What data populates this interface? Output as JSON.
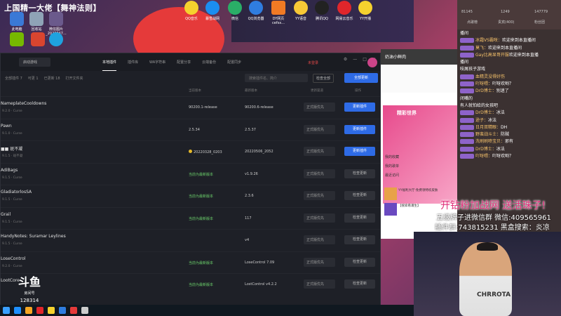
{
  "stream": {
    "title": "上国精一大佬【舞神法则】",
    "douyu_logo": "斗鱼",
    "douyu_sub": "房间号",
    "room_id": "128314"
  },
  "desktop_icons": [
    "此电脑",
    "回收站",
    "微信图片_2022047..."
  ],
  "top_icons": [
    "QQ音乐",
    "暴雪战网",
    "微信",
    "QQ浏览器",
    "DY网页cefsx...",
    "YY语音",
    "腾讯QQ",
    "网易云音乐",
    "YY开播"
  ],
  "plugin_window": {
    "game_select": "启动游戏",
    "tabs": [
      "本地插件",
      "插件库",
      "WA字符串",
      "配置分享",
      "云端备份",
      "配置同步"
    ],
    "active_tab": 0,
    "login": "未登录",
    "toolbar": [
      "全部插件 7",
      "可更 1",
      "已更新 18",
      "打开文件夹"
    ],
    "search_placeholder": "搜索插件名、简介",
    "check_all": "检查全部",
    "update_all": "全部更新",
    "columns": [
      "当前版本",
      "最新版本",
      "更新渠道",
      "操作"
    ],
    "rows": [
      {
        "name": "NameplateCooldowns",
        "meta": "9.2.0 · Curse",
        "current": "90200.1-release",
        "latest": "90200.6-release",
        "channel": "正式版优先",
        "action": "更新插件",
        "latest_flag": false,
        "warn": false
      },
      {
        "name": "Pawn",
        "meta": "9.1.0 · Curse",
        "current": "2.5.34",
        "latest": "2.5.37",
        "channel": "正式版优先",
        "action": "更新插件",
        "latest_flag": false,
        "warn": false
      },
      {
        "name": "■■ 斑不凝",
        "meta": "9.1.5 · 斑不凝",
        "current": "20220328_0203",
        "latest": "20220506_2052",
        "channel": "正式版优先",
        "action": "更新插件",
        "latest_flag": false,
        "warn": true
      },
      {
        "name": "AdiBags",
        "meta": "9.1.5 · Curse",
        "current": "当前为最新版本",
        "latest": "v1.9.26",
        "channel": "正式版优先",
        "action": "检查更新",
        "latest_flag": true,
        "warn": false
      },
      {
        "name": "GladiatorlosSA",
        "meta": "9.1.5 · Curse",
        "current": "当前为最新版本",
        "latest": "2.3.6",
        "channel": "正式版优先",
        "action": "检查更新",
        "latest_flag": true,
        "warn": false
      },
      {
        "name": "Grail",
        "meta": "9.1.5 · Curse",
        "current": "当前为最新版本",
        "latest": "117",
        "channel": "正式版优先",
        "action": "检查更新",
        "latest_flag": true,
        "warn": false
      },
      {
        "name": "HandyNotes: Suramar Leylines",
        "meta": "9.1.5 · Curse",
        "current": "",
        "latest": "v4",
        "channel": "正式版优先",
        "action": "检查更新",
        "latest_flag": true,
        "warn": false
      },
      {
        "name": "LoseControl",
        "meta": "9.2.0 · Curse",
        "current": "当前为最新版本",
        "latest": "LoseControl 7.09",
        "channel": "正式版优先",
        "action": "检查更新",
        "latest_flag": true,
        "warn": false
      },
      {
        "name": "LootCore",
        "meta": "",
        "current": "当前为最新版本",
        "latest": "LostControl v4.2.2",
        "channel": "正式版优先",
        "action": "检查更新",
        "latest_flag": true,
        "warn": false
      }
    ]
  },
  "music": {
    "head": "奶油小鲜肉",
    "banner_title": "精彩世界",
    "items": [
      "我的收藏",
      "我的歌单",
      "最近访问"
    ],
    "yy_items": [
      "YY福利大厅·免费领特权皮肤",
      "【搜索看潘生】"
    ]
  },
  "chat": {
    "stats": [
      "81145",
      "1249",
      "147779"
    ],
    "sub": [
      "点歌榜",
      "贵宾(400)",
      "粉丝团"
    ],
    "lines": [
      {
        "user": "",
        "text": "播间"
      },
      {
        "user": "冰霜VS霸咲：",
        "text": "欢迎来到本直播间"
      },
      {
        "user": "莫飞：",
        "text": "欢迎来到本直播间"
      },
      {
        "user": "Gay比高显哥开服",
        "text": "欢迎来到本直播"
      },
      {
        "user": "",
        "text": "播间"
      },
      {
        "user": "",
        "text": "吱屑孩子游戏"
      },
      {
        "user": "血精灵没得好伤",
        "text": ""
      },
      {
        "user": "吖呀喂：",
        "text": "吖呀欢哟？"
      },
      {
        "user": "DrD博士：",
        "text": "别迷了"
      },
      {
        "user": "",
        "text": "闭嘴的"
      },
      {
        "user": "",
        "text": "有人就怕给的女孩吧"
      },
      {
        "user": "DrD博士：",
        "text": "冰法"
      },
      {
        "user": "逊子：",
        "text": "冰法"
      },
      {
        "user": "日月双精眼：",
        "text": "DH"
      },
      {
        "user": "野蛮战斗士：",
        "text": "防贼"
      },
      {
        "user": "洗刷刷喷宝贝：",
        "text": "邪有"
      },
      {
        "user": "DrD博士：",
        "text": "冰法"
      },
      {
        "user": "吖呀喂：",
        "text": "吖呀欢哟？"
      }
    ]
  },
  "promo": {
    "line1": "开钻粉加战网 送活珠子!",
    "line2": "五级牌子进微信群 微信:409565961",
    "line3": "插件群:743815231 黑盒搜索：炎凉"
  },
  "webcam": {
    "shirt": "CHRROTA"
  }
}
